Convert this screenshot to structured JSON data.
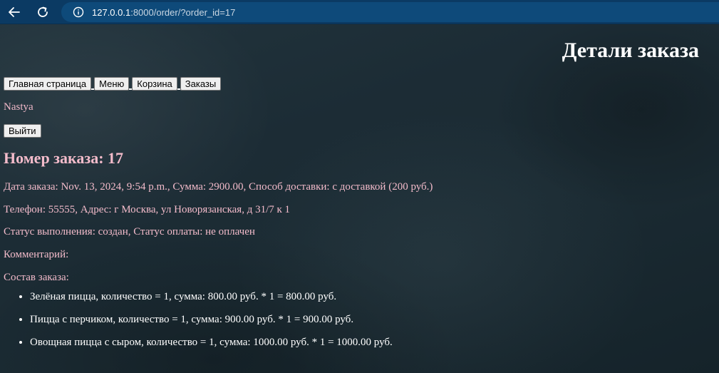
{
  "browser": {
    "url_host": "127.0.0.1",
    "url_rest": ":8000/order/?order_id=17"
  },
  "page": {
    "title": "Детали заказа",
    "menu": [
      "Главная страница",
      "Меню",
      "Корзина",
      "Заказы"
    ],
    "username": "Nastya",
    "logout_label": "Выйти",
    "order_heading": "Номер заказа: 17",
    "lines": [
      "Дата заказа: Nov. 13, 2024, 9:54 p.m., Сумма: 2900.00, Способ доставки: с доставкой (200 руб.)",
      "Телефон: 55555, Адрес: г Москва, ул Новорязанская, д 31/7 к 1",
      "Статус выполнения: создан, Статус оплаты: не оплачен",
      "Комментарий:",
      "Состав заказа:"
    ],
    "items": [
      "Зелёная пицца, количество = 1, сумма: 800.00 руб. * 1 = 800.00 руб.",
      "Пицца с перчиком, количество = 1, сумма: 900.00 руб. * 1 = 900.00 руб.",
      "Овощная пицца с сыром, количество = 1, сумма: 1000.00 руб. * 1 = 1000.00 руб."
    ]
  },
  "icons": {
    "back": "arrow-left-icon",
    "reload": "reload-icon",
    "site_info": "info-icon"
  },
  "colors": {
    "browser_bar": "#0b3a63",
    "text_pink": "#f4bccb",
    "title_white": "#ffffff"
  }
}
